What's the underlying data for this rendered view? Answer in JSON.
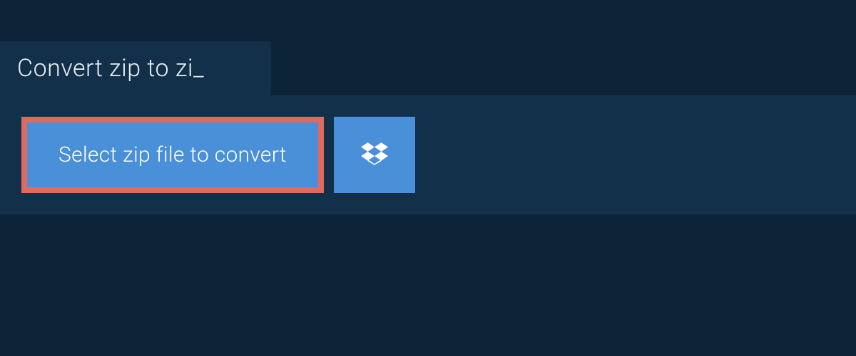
{
  "tab": {
    "title": "Convert zip to zi_"
  },
  "actions": {
    "select_label": "Select zip file to convert"
  },
  "colors": {
    "background": "#0d2438",
    "panel": "#13304b",
    "button": "#4a90d9",
    "highlight_border": "#e16a5f",
    "text_light": "#ffffff"
  }
}
